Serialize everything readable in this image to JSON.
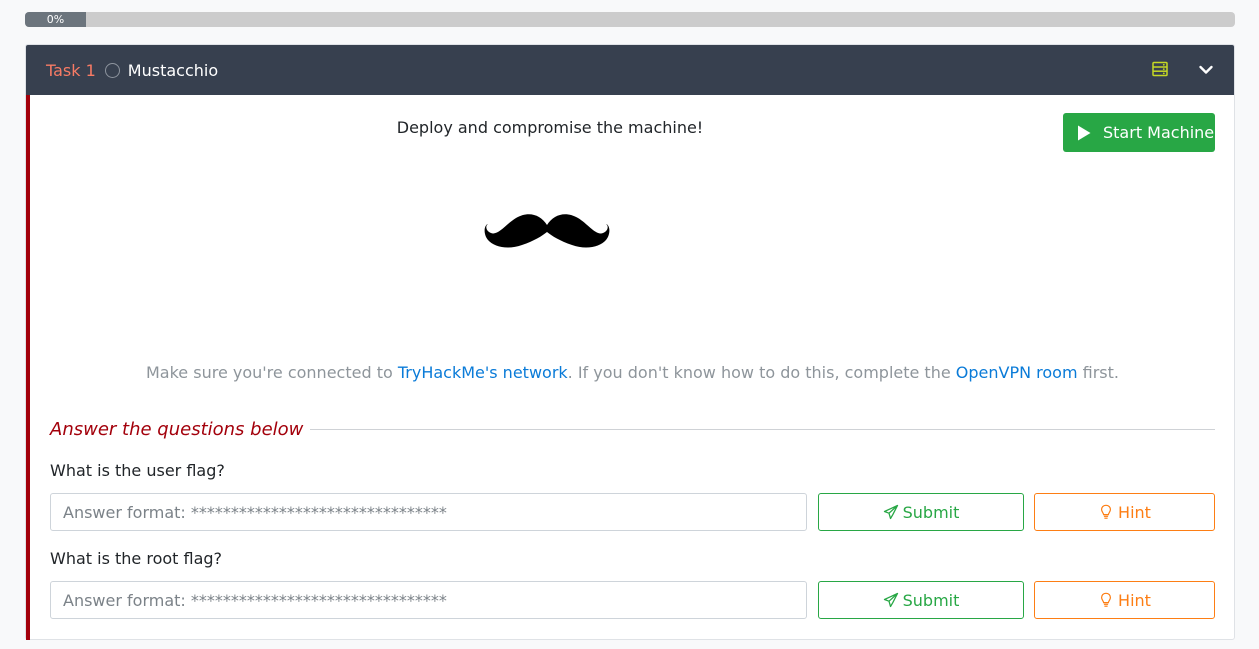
{
  "progress": {
    "label": "0%",
    "value_percent": 0
  },
  "task": {
    "number_label": "Task 1",
    "title": "Mustacchio",
    "status_icon": "circle-outline-icon",
    "header_icons": [
      "server-icon",
      "chevron-down-icon"
    ]
  },
  "body": {
    "deploy_text": "Deploy and compromise the machine!",
    "start_button_label": "Start Machine",
    "image_icon": "mustache-icon",
    "vpn_note": {
      "prefix": "Make sure you're connected to ",
      "network_link": "TryHackMe's network",
      "middle": ". If you don't know how to do this, complete the ",
      "openvpn_link": "OpenVPN room",
      "suffix": " first."
    }
  },
  "questions_section": {
    "heading": "Answer the questions below",
    "questions": [
      {
        "text": "What is the user flag?",
        "placeholder": "Answer format: ********************************",
        "submit_label": "Submit",
        "hint_label": "Hint"
      },
      {
        "text": "What is the root flag?",
        "placeholder": "Answer format: ********************************",
        "submit_label": "Submit",
        "hint_label": "Hint"
      }
    ]
  },
  "colors": {
    "header_bg": "#37404f",
    "task_number": "#f77b65",
    "accent_red": "#a3000b",
    "success_green": "#28a745",
    "hint_orange": "#fd7e14",
    "link_blue": "#0a7bd8",
    "server_icon": "#c6d925"
  }
}
